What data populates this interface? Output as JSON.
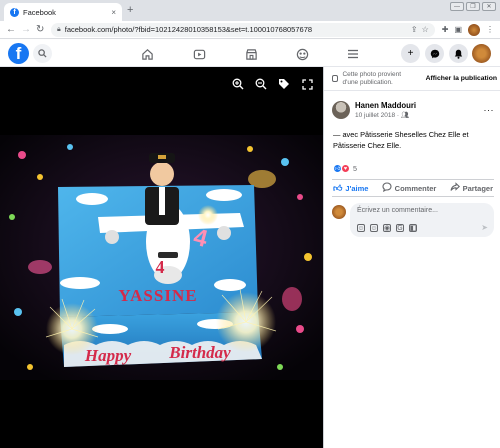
{
  "browser": {
    "tab_title": "Facebook",
    "tab_close": "×",
    "new_tab": "+",
    "url": "facebook.com/photo/?fbid=10212428010358153&set=t.100010768057678",
    "window_controls": [
      "—",
      "❐",
      "✕"
    ]
  },
  "header": {
    "logo_letter": "f"
  },
  "panel": {
    "notice_text": "Cette photo provient d'une publication.",
    "notice_button": "Afficher la publication",
    "author_name": "Hanen Maddouri",
    "post_date": "10 juillet 2018 ·",
    "more_label": "···",
    "post_text": "— avec Pâtisserie Sheselles Chez Elle et Pâtisserie Chez Elle.",
    "reaction_count": "5",
    "actions": {
      "like": "J'aime",
      "comment": "Commenter",
      "share": "Partager"
    },
    "comment_placeholder": "Écrivez un commentaire..."
  },
  "cake": {
    "name_text": "YASSINE",
    "number_text": "4",
    "greeting_left": "Happy",
    "greeting_right": "Birthday"
  },
  "colors": {
    "facebook_blue": "#1877f2",
    "love_red": "#f33e58",
    "cake_blue": "#3ba3e0"
  }
}
